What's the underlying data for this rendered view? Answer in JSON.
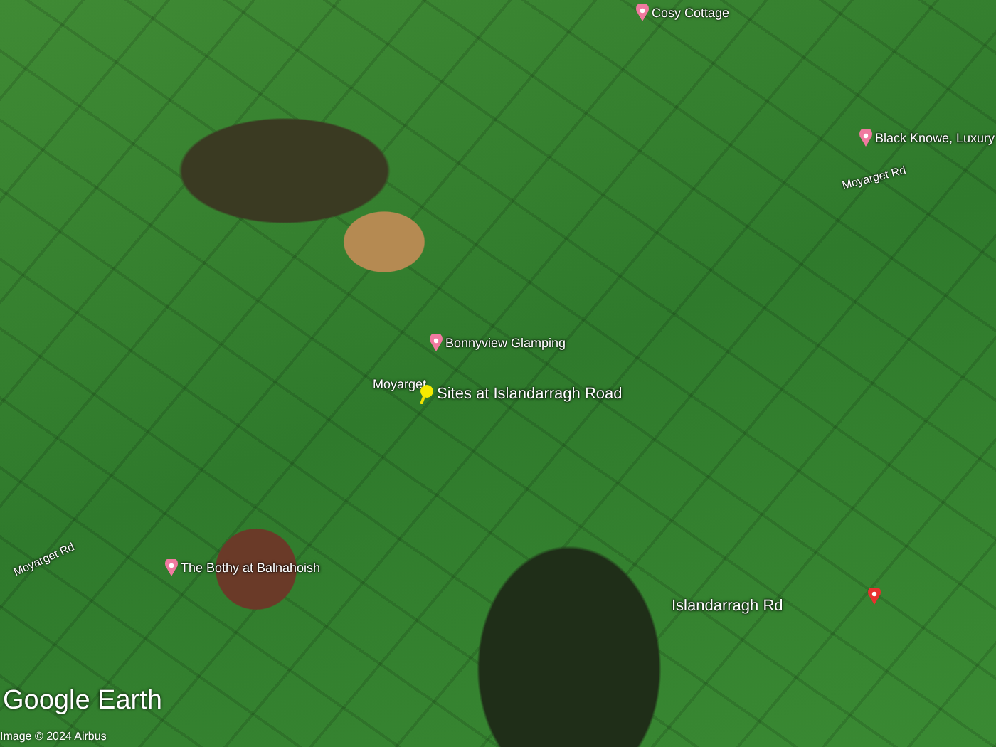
{
  "map": {
    "labels": [
      {
        "kind": "poi",
        "text": "Cosy Cottage"
      },
      {
        "kind": "poi",
        "text": "Black Knowe, Luxury"
      },
      {
        "kind": "road",
        "text": "Moyarget Rd"
      },
      {
        "kind": "poi",
        "text": "Bonnyview Glamping"
      },
      {
        "kind": "town",
        "text": "Moyarget"
      },
      {
        "kind": "placemark",
        "text": "Sites at Islandarragh Road"
      },
      {
        "kind": "road",
        "text": "Moyarget Rd"
      },
      {
        "kind": "poi",
        "text": "The Bothy at Balnahoish"
      },
      {
        "kind": "dropped_pin",
        "text": "Islandarragh Rd"
      }
    ]
  },
  "brand": {
    "logo": "Google Earth",
    "attribution": "Image © 2024 Airbus"
  }
}
